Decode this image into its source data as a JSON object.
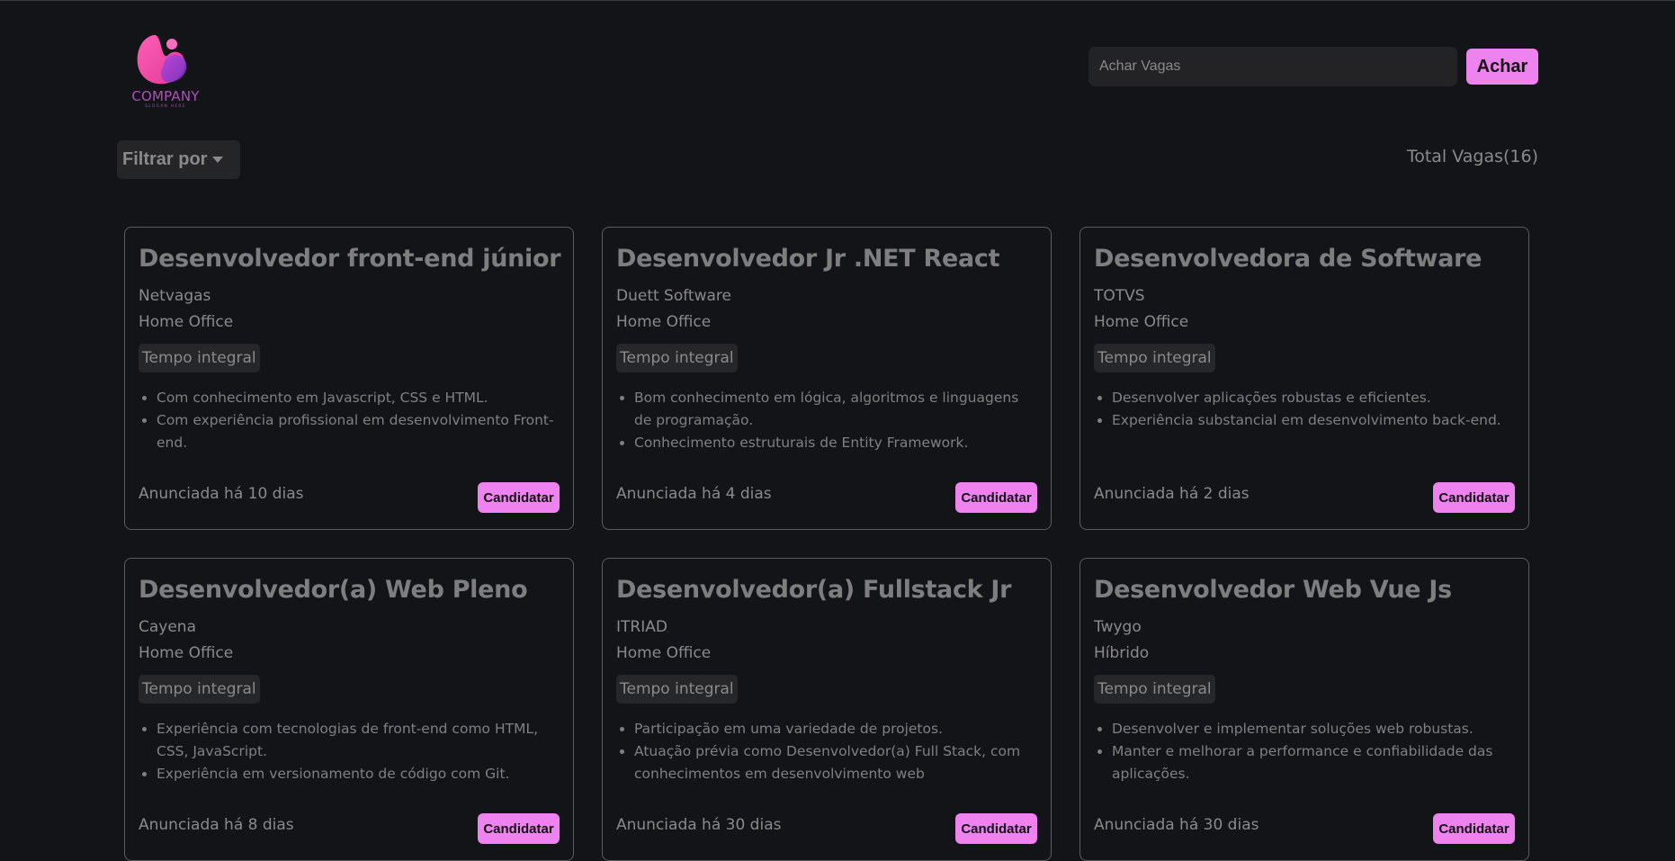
{
  "header": {
    "logo": {
      "text": "COMPANY",
      "slogan": "SLOGAN HERE"
    },
    "search": {
      "placeholder": "Achar Vagas",
      "value": "",
      "button_label": "Achar"
    }
  },
  "toolbar": {
    "filter_label": "Filtrar por",
    "total_label": "Total Vagas(16)"
  },
  "colors": {
    "accent": "#ee82ee",
    "background": "#131417"
  },
  "jobs": [
    {
      "title": "Desenvolvedor front-end júnior",
      "company": "Netvagas",
      "location": "Home Office",
      "type": "Tempo integral",
      "requirements": [
        "Com conhecimento em Javascript, CSS e HTML.",
        "Com experiência profissional em desenvolvimento Front-end."
      ],
      "posted": "Anunciada há 10 dias",
      "apply_label": "Candidatar"
    },
    {
      "title": "Desenvolvedor Jr .NET React",
      "company": "Duett Software",
      "location": "Home Office",
      "type": "Tempo integral",
      "requirements": [
        "Bom conhecimento em lógica, algoritmos e linguagens de programação.",
        "Conhecimento estruturais de Entity Framework."
      ],
      "posted": "Anunciada há 4 dias",
      "apply_label": "Candidatar"
    },
    {
      "title": "Desenvolvedora de Software",
      "company": "TOTVS",
      "location": "Home Office",
      "type": "Tempo integral",
      "requirements": [
        "Desenvolver aplicações robustas e eficientes.",
        "Experiência substancial em desenvolvimento back-end."
      ],
      "posted": "Anunciada há 2 dias",
      "apply_label": "Candidatar"
    },
    {
      "title": "Desenvolvedor(a) Web Pleno",
      "company": "Cayena",
      "location": "Home Office",
      "type": "Tempo integral",
      "requirements": [
        "Experiência com tecnologias de front-end como HTML, CSS, JavaScript.",
        "Experiência em versionamento de código com Git."
      ],
      "posted": "Anunciada há 8 dias",
      "apply_label": "Candidatar"
    },
    {
      "title": "Desenvolvedor(a) Fullstack Jr",
      "company": "ITRIAD",
      "location": "Home Office",
      "type": "Tempo integral",
      "requirements": [
        "Participação em uma variedade de projetos.",
        "Atuação prévia como Desenvolvedor(a) Full Stack, com conhecimentos em desenvolvimento web"
      ],
      "posted": "Anunciada há 30 dias",
      "apply_label": "Candidatar"
    },
    {
      "title": "Desenvolvedor Web Vue Js",
      "company": "Twygo",
      "location": "Híbrido",
      "type": "Tempo integral",
      "requirements": [
        "Desenvolver e implementar soluções web robustas.",
        "Manter e melhorar a performance e confiabilidade das aplicações."
      ],
      "posted": "Anunciada há 30 dias",
      "apply_label": "Candidatar"
    }
  ]
}
